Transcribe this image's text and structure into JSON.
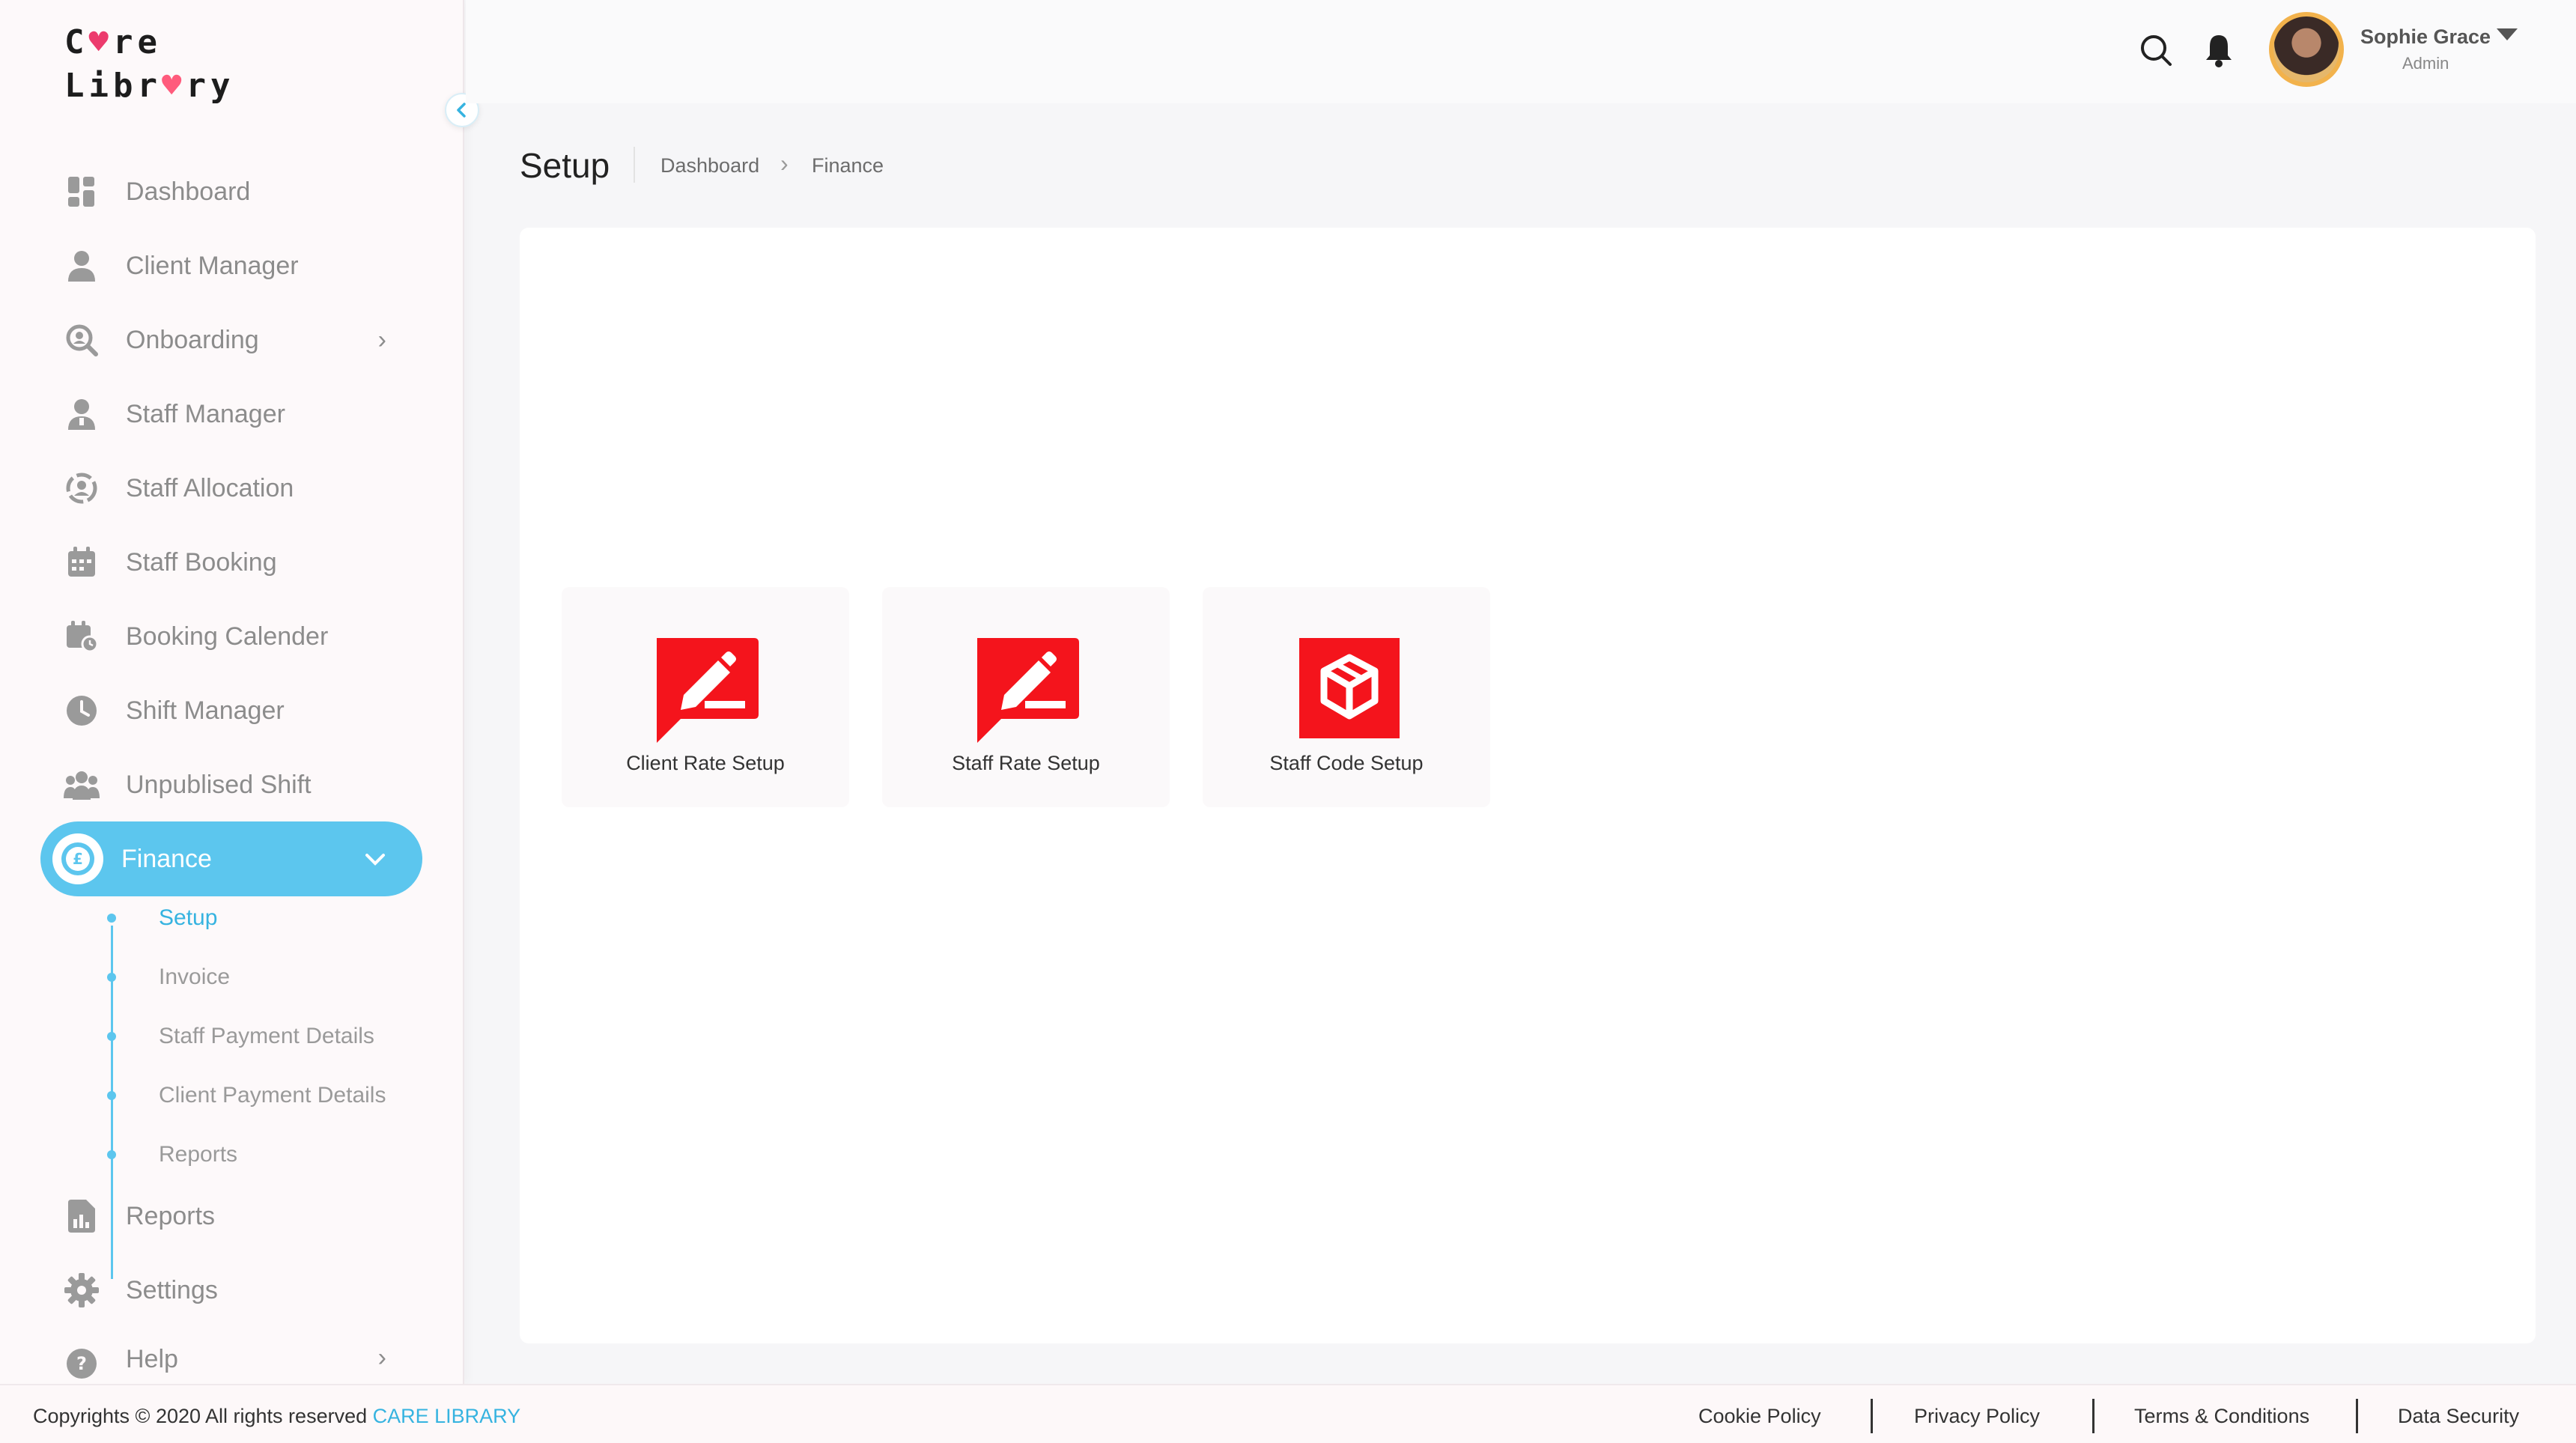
{
  "brand": {
    "logo_line1_a": "C",
    "logo_line1_b": "re",
    "logo_line2_a": "Libr",
    "logo_line2_b": "ry"
  },
  "sidebar": {
    "items": [
      {
        "label": "Dashboard",
        "icon": "dashboard-icon"
      },
      {
        "label": "Client Manager",
        "icon": "client-icon"
      },
      {
        "label": "Onboarding",
        "icon": "onboarding-icon"
      },
      {
        "label": "Staff Manager",
        "icon": "staff-icon"
      },
      {
        "label": "Staff Allocation",
        "icon": "allocation-icon"
      },
      {
        "label": "Staff Booking",
        "icon": "booking-icon"
      },
      {
        "label": "Booking Calender",
        "icon": "calendar-icon"
      },
      {
        "label": "Shift Manager",
        "icon": "clock-icon"
      },
      {
        "label": "Unpublised Shift",
        "icon": "group-icon"
      },
      {
        "label": "Finance",
        "icon": "pound-icon"
      },
      {
        "label": "Reports",
        "icon": "report-icon"
      },
      {
        "label": "Settings",
        "icon": "gear-icon"
      },
      {
        "label": "Help",
        "icon": "help-icon"
      }
    ],
    "finance_sub": [
      "Setup",
      "Invoice",
      "Staff Payment Details",
      "Client Payment Details",
      "Reports"
    ],
    "active_item": "Finance",
    "active_sub": "Setup"
  },
  "header": {
    "user_name": "Sophie Grace",
    "user_role": "Admin"
  },
  "page": {
    "title": "Setup",
    "breadcrumb": [
      "Dashboard",
      "Finance"
    ]
  },
  "tiles": [
    {
      "label": "Client Rate Setup",
      "icon": "edit-chat-icon"
    },
    {
      "label": "Staff Rate Setup",
      "icon": "edit-chat-icon"
    },
    {
      "label": "Staff Code Setup",
      "icon": "cube-icon"
    }
  ],
  "footer": {
    "copyright": "Copyrights © 2020  All rights reserved",
    "brand": "CARE LIBRARY",
    "links": [
      "Cookie Policy",
      "Privacy Policy",
      "Terms & Conditions",
      "Data Security"
    ]
  },
  "colors": {
    "accent": "#5cc6ee",
    "tile_icon": "#f4141c",
    "logo_heart": "#ec3b6d"
  }
}
